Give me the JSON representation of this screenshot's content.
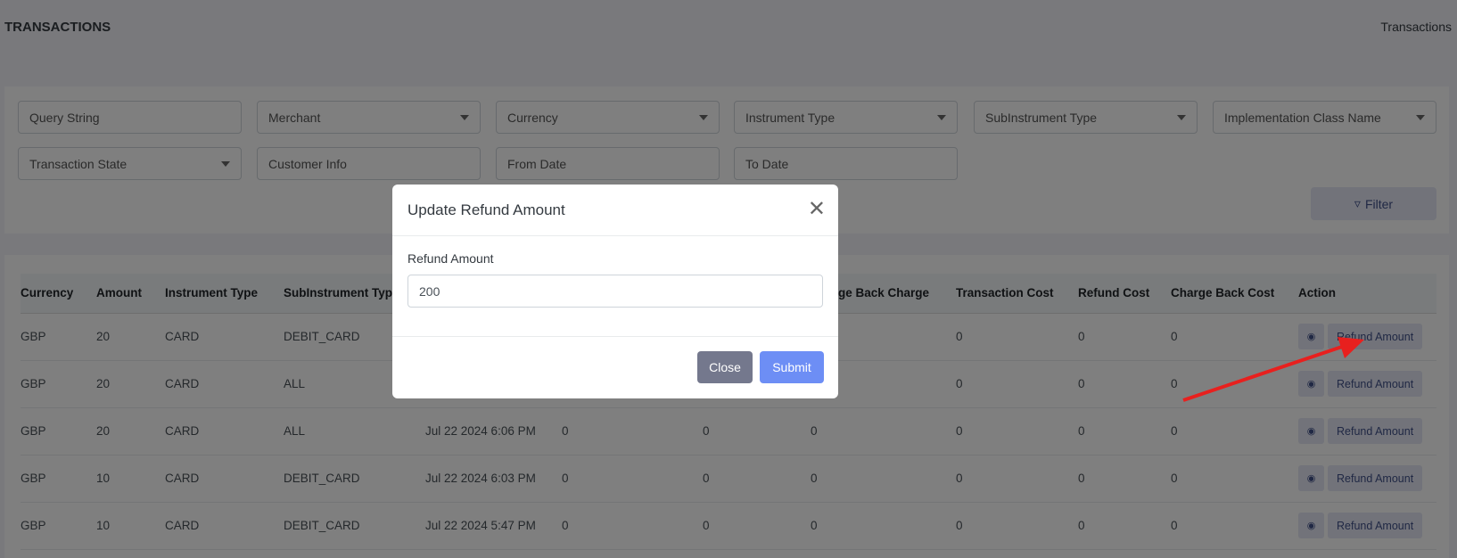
{
  "header": {
    "title": "TRANSACTIONS",
    "breadcrumb": "Transactions"
  },
  "filters": {
    "query_string": "Query String",
    "merchant": "Merchant",
    "currency": "Currency",
    "instrument_type": "Instrument Type",
    "subinstrument_type": "SubInstrument Type",
    "implementation_class": "Implementation Class Name",
    "transaction_state": "Transaction State",
    "customer_info": "Customer Info",
    "from_date": "From Date",
    "to_date": "To Date",
    "filter_button": "Filter",
    "filter_icon": "funnel-icon"
  },
  "table": {
    "headers": [
      "Currency",
      "Amount",
      "Instrument Type",
      "SubInstrument Type",
      "",
      "",
      "",
      "Charge Back Charge",
      "Transaction Cost",
      "Refund Cost",
      "Charge Back Cost",
      "Action"
    ],
    "rows": [
      [
        "GBP",
        "20",
        "CARD",
        "DEBIT_CARD",
        "",
        "",
        "",
        "",
        "0",
        "0",
        "0"
      ],
      [
        "GBP",
        "20",
        "CARD",
        "ALL",
        "",
        "",
        "",
        "",
        "0",
        "0",
        "0"
      ],
      [
        "GBP",
        "20",
        "CARD",
        "ALL",
        "Jul 22 2024 6:06 PM",
        "0",
        "0",
        "0",
        "0",
        "0",
        "0"
      ],
      [
        "GBP",
        "10",
        "CARD",
        "DEBIT_CARD",
        "Jul 22 2024 6:03 PM",
        "0",
        "0",
        "0",
        "0",
        "0",
        "0"
      ],
      [
        "GBP",
        "10",
        "CARD",
        "DEBIT_CARD",
        "Jul 22 2024 5:47 PM",
        "0",
        "0",
        "0",
        "0",
        "0",
        "0"
      ]
    ],
    "action_label": "Refund Amount",
    "view_icon": "eye-icon"
  },
  "modal": {
    "title": "Update Refund Amount",
    "field_label": "Refund Amount",
    "field_value": "200",
    "close_label": "Close",
    "submit_label": "Submit"
  },
  "annotation": {
    "arrow_color": "#e8201e"
  }
}
